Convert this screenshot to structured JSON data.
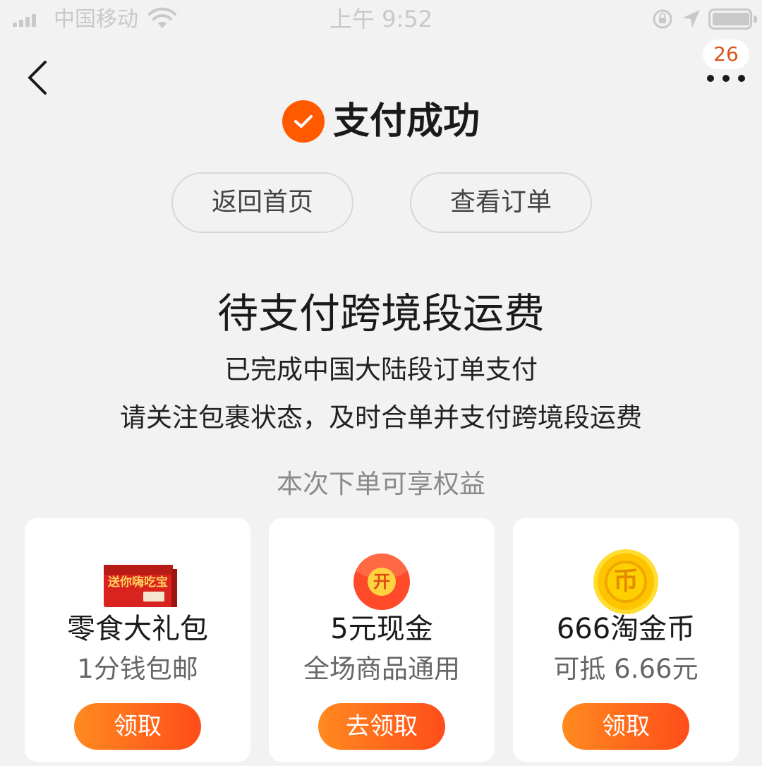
{
  "status_bar": {
    "carrier": "中国移动",
    "time": "上午 9:52"
  },
  "nav": {
    "badge_count": "26"
  },
  "success": {
    "title": "支付成功"
  },
  "actions": {
    "home_label": "返回首页",
    "order_label": "查看订单"
  },
  "pending": {
    "title": "待支付跨境段运费",
    "line1": "已完成中国大陆段订单支付",
    "line2": "请关注包裹状态，及时合单并支付跨境段运费"
  },
  "benefits": {
    "title": "本次下单可享权益",
    "cards": [
      {
        "icon": "gift-box-icon",
        "name": "零食大礼包",
        "sub": "1分钱包邮",
        "button": "领取",
        "image_text": "送你嗨吃宝"
      },
      {
        "icon": "red-envelope-icon",
        "name": "5元现金",
        "sub": "全场商品通用",
        "button": "去领取",
        "image_text": "开"
      },
      {
        "icon": "gold-coin-icon",
        "name": "666淘金币",
        "sub": "可抵 6.66元",
        "button": "领取",
        "image_text": "币"
      }
    ]
  },
  "colors": {
    "accent": "#ff5a00",
    "background": "#f2f2f2",
    "badge_text": "#d9541a"
  }
}
